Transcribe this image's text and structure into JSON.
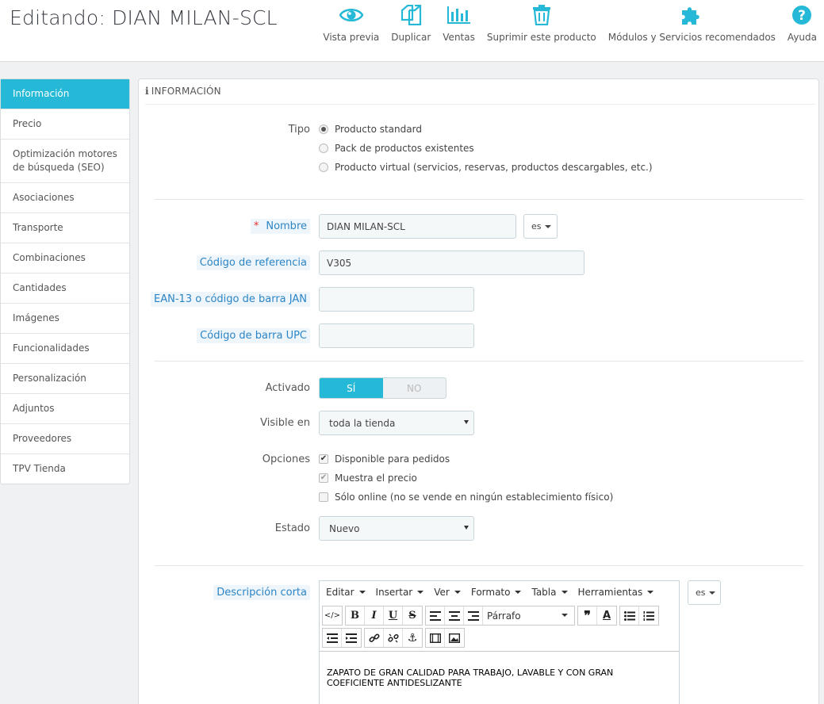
{
  "header": {
    "title": "Editando: DIAN MILAN-SCL",
    "toolbar": [
      {
        "label": "Vista previa",
        "icon": "eye-icon"
      },
      {
        "label": "Duplicar",
        "icon": "duplicate-icon"
      },
      {
        "label": "Ventas",
        "icon": "bar-chart-icon"
      },
      {
        "label": "Suprimir este producto",
        "icon": "trash-icon"
      },
      {
        "label": "Módulos y Servicios recomendados",
        "icon": "puzzle-icon"
      },
      {
        "label": "Ayuda",
        "icon": "help-icon"
      }
    ]
  },
  "sidebar": {
    "items": [
      {
        "label": "Información",
        "active": true
      },
      {
        "label": "Precio"
      },
      {
        "label": "Optimización motores de búsqueda (SEO)"
      },
      {
        "label": "Asociaciones"
      },
      {
        "label": "Transporte"
      },
      {
        "label": "Combinaciones"
      },
      {
        "label": "Cantidades"
      },
      {
        "label": "Imágenes"
      },
      {
        "label": "Funcionalidades"
      },
      {
        "label": "Personalización"
      },
      {
        "label": "Adjuntos"
      },
      {
        "label": "Proveedores"
      },
      {
        "label": "TPV Tienda"
      }
    ]
  },
  "panel": {
    "heading_icon": "i",
    "heading": "INFORMACIÓN",
    "tipo": {
      "label": "Tipo",
      "options": [
        {
          "label": "Producto standard",
          "selected": true
        },
        {
          "label": "Pack de productos existentes",
          "selected": false
        },
        {
          "label": "Producto virtual (servicios, reservas, productos descargables, etc.)",
          "selected": false
        }
      ]
    },
    "nombre": {
      "required_mark": "*",
      "label": "Nombre",
      "value": "DIAN MILAN-SCL",
      "lang": "es"
    },
    "referencia": {
      "label": "Código de referencia",
      "value": "V305"
    },
    "ean13": {
      "label": "EAN-13 o código de barra JAN",
      "value": ""
    },
    "upc": {
      "label": "Código de barra UPC",
      "value": ""
    },
    "activado": {
      "label": "Activado",
      "on_label": "SÍ",
      "off_label": "NO",
      "value": "SÍ"
    },
    "visible": {
      "label": "Visible en",
      "value": "toda la tienda"
    },
    "opciones": {
      "label": "Opciones",
      "items": [
        {
          "label": "Disponible para pedidos",
          "checked": true
        },
        {
          "label": "Muestra el precio",
          "checked": true,
          "disabled": true
        },
        {
          "label": "Sólo online (no se vende en ningún establecimiento físico)",
          "checked": false
        }
      ]
    },
    "estado": {
      "label": "Estado",
      "value": "Nuevo"
    },
    "descripcion": {
      "label": "Descripción corta",
      "lang": "es",
      "menus": [
        "Editar",
        "Insertar",
        "Ver",
        "Formato",
        "Tabla",
        "Herramientas"
      ],
      "format": "Párrafo",
      "content": "ZAPATO DE GRAN CALIDAD PARA TRABAJO, LAVABLE Y CON GRAN COEFICIENTE ANTIDESLIZANTE"
    }
  }
}
